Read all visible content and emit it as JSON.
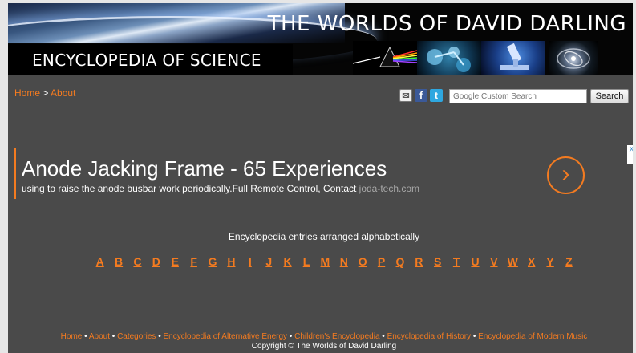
{
  "header": {
    "title": "THE WORLDS OF DAVID DARLING",
    "subtitle": "ENCYCLOPEDIA OF SCIENCE"
  },
  "breadcrumb": {
    "home": "Home",
    "separator": " > ",
    "current": "About"
  },
  "tools": {
    "search_placeholder": "Google Custom Search",
    "search_button": "Search",
    "icons": [
      "email-icon",
      "facebook-icon",
      "twitter-icon"
    ]
  },
  "ad": {
    "title": "Anode Jacking Frame - 65 Experiences",
    "text": "using to raise the anode busbar work periodically.Full Remote Control, Contact ",
    "domain": "joda-tech.com",
    "arrow": "›",
    "choices": "X"
  },
  "entries_label": "Encyclopedia entries arranged alphabetically",
  "alphabet": [
    "A",
    "B",
    "C",
    "D",
    "E",
    "F",
    "G",
    "H",
    "I",
    "J",
    "K",
    "L",
    "M",
    "N",
    "O",
    "P",
    "Q",
    "R",
    "S",
    "T",
    "U",
    "V",
    "W",
    "X",
    "Y",
    "Z"
  ],
  "footer": {
    "links": [
      "Home",
      "About",
      "Categories",
      "Encyclopedia of Alternative Energy",
      "Children's Encyclopedia",
      "Encyclopedia of History",
      "Encyclopedia of Modern Music"
    ],
    "separator": " • ",
    "copyright": "Copyright © The Worlds of David Darling"
  },
  "colors": {
    "accent": "#f47b20",
    "background": "#4a4a4a",
    "header": "#050505"
  }
}
